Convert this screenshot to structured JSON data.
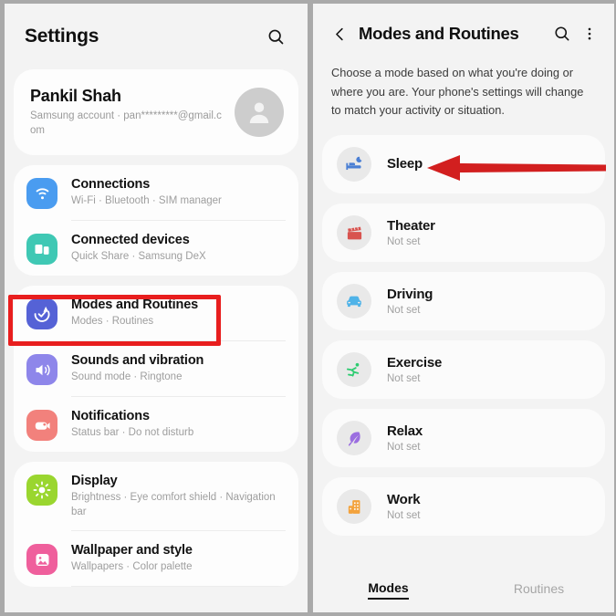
{
  "left_panel": {
    "header": {
      "title": "Settings",
      "search_icon": "search-icon"
    },
    "account": {
      "name": "Pankil Shah",
      "subtitle": "Samsung account  ·  pan*********@gmail.com",
      "avatar_icon": "person-avatar-icon"
    },
    "groups": [
      {
        "items": [
          {
            "title": "Connections",
            "subtitle": "Wi-Fi  ·  Bluetooth  ·  SIM manager",
            "icon": "wifi-icon",
            "icon_color": "#4a9cf0",
            "highlighted": false
          },
          {
            "title": "Connected devices",
            "subtitle": "Quick Share  ·  Samsung DeX",
            "icon": "connected-devices-icon",
            "icon_color": "#3fc8b4",
            "highlighted": false
          }
        ]
      },
      {
        "items": [
          {
            "title": "Modes and Routines",
            "subtitle": "Modes  ·  Routines",
            "icon": "modes-routines-icon",
            "icon_color": "#5562d6",
            "highlighted": true
          },
          {
            "title": "Sounds and vibration",
            "subtitle": "Sound mode  ·  Ringtone",
            "icon": "speaker-icon",
            "icon_color": "#8e86ea",
            "highlighted": false
          },
          {
            "title": "Notifications",
            "subtitle": "Status bar  ·  Do not disturb",
            "icon": "notifications-icon",
            "icon_color": "#f2817c",
            "highlighted": false
          }
        ]
      },
      {
        "items": [
          {
            "title": "Display",
            "subtitle": "Brightness  ·  Eye comfort shield  ·  Navigation bar",
            "icon": "brightness-icon",
            "icon_color": "#9ad62f",
            "highlighted": false
          },
          {
            "title": "Wallpaper and style",
            "subtitle": "Wallpapers  ·  Color palette",
            "icon": "wallpaper-icon",
            "icon_color": "#ef5f9c",
            "highlighted": false
          }
        ]
      }
    ]
  },
  "right_panel": {
    "header": {
      "back_icon": "chevron-left-icon",
      "title": "Modes and Routines",
      "search_icon": "search-icon",
      "more_icon": "more-vertical-icon"
    },
    "description": "Choose a mode based on what you're doing or where you are. Your phone's settings will change to match your activity or situation.",
    "modes": [
      {
        "title": "Sleep",
        "subtitle": "",
        "icon": "bed-moon-icon",
        "icon_color": "#4a7fd4",
        "annotated": true
      },
      {
        "title": "Theater",
        "subtitle": "Not set",
        "icon": "clapperboard-icon",
        "icon_color": "#d8534f",
        "annotated": false
      },
      {
        "title": "Driving",
        "subtitle": "Not set",
        "icon": "car-icon",
        "icon_color": "#4fb3e8",
        "annotated": false
      },
      {
        "title": "Exercise",
        "subtitle": "Not set",
        "icon": "running-icon",
        "icon_color": "#2ecc71",
        "annotated": false
      },
      {
        "title": "Relax",
        "subtitle": "Not set",
        "icon": "leaf-icon",
        "icon_color": "#9b6ee0",
        "annotated": false
      },
      {
        "title": "Work",
        "subtitle": "Not set",
        "icon": "office-building-icon",
        "icon_color": "#f3a23c",
        "annotated": false
      }
    ],
    "tabs": [
      {
        "label": "Modes",
        "active": true
      },
      {
        "label": "Routines",
        "active": false
      }
    ]
  },
  "annotations": {
    "highlight_color": "#e81e1e",
    "arrow_color": "#d21f1f",
    "box_target": "Modes and Routines",
    "arrow_target": "Sleep"
  }
}
